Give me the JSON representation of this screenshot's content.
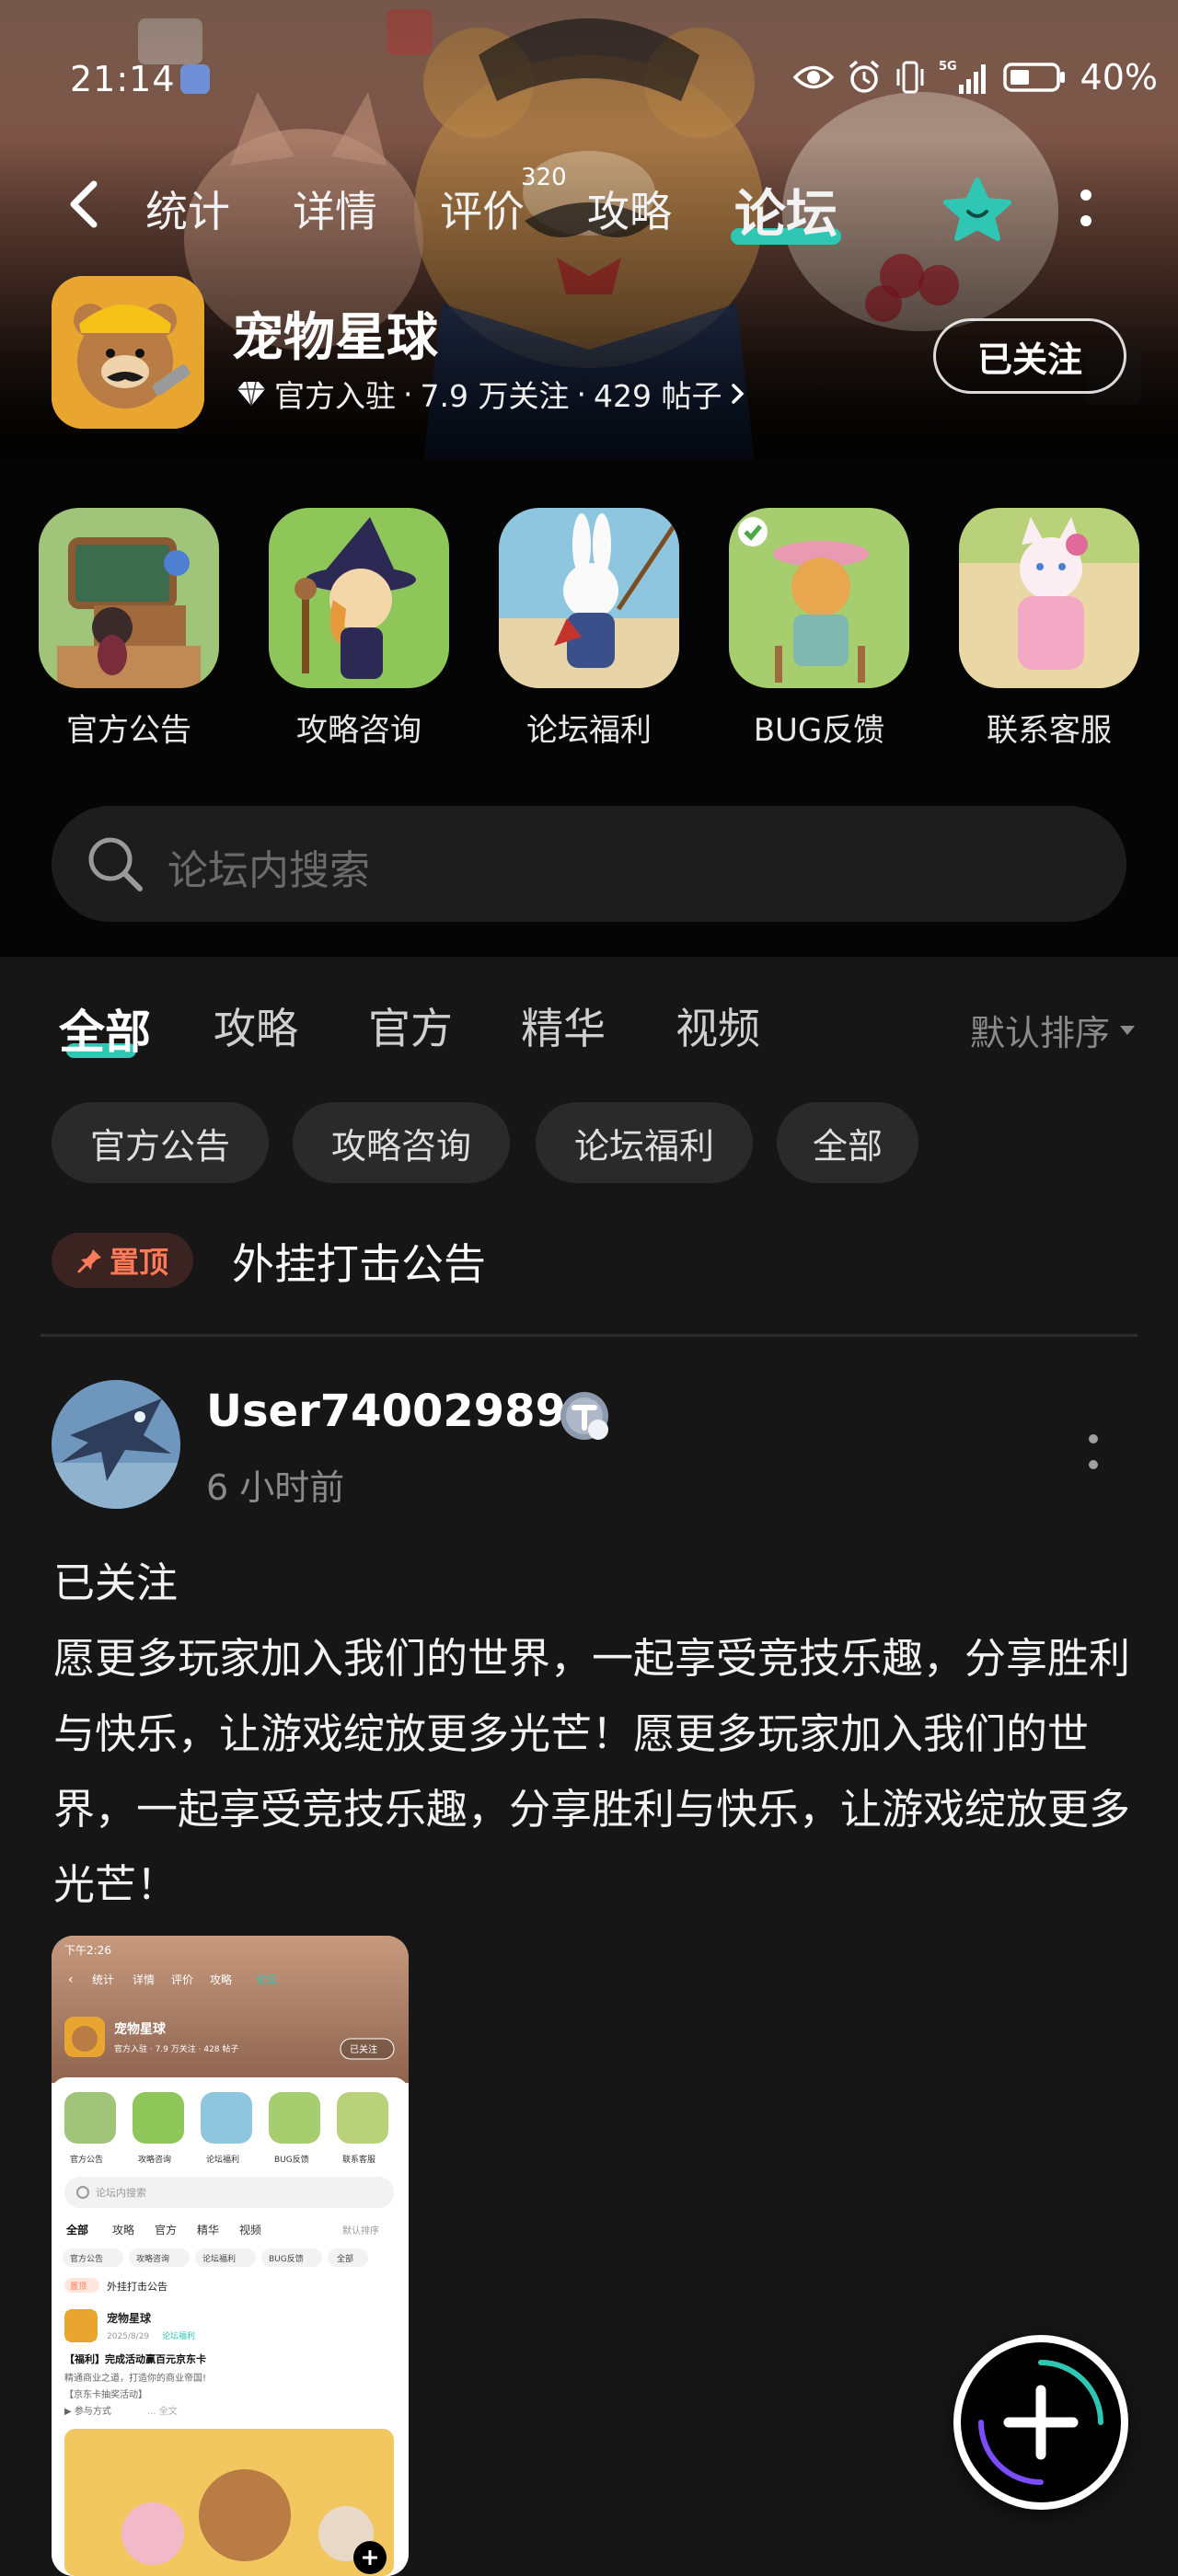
{
  "status_bar": {
    "time": "21:14",
    "network": "5G",
    "battery": "40%"
  },
  "nav": {
    "tabs": [
      {
        "label": "统计"
      },
      {
        "label": "详情"
      },
      {
        "label": "评价",
        "count": "320"
      },
      {
        "label": "攻略"
      },
      {
        "label": "论坛",
        "active": true
      }
    ],
    "accent": "#2fc7b4"
  },
  "game": {
    "title": "宠物星球",
    "official": "官方入驻",
    "followers": "7.9 万关注",
    "posts": "429 帖子",
    "sep": "·",
    "follow_label": "已关注"
  },
  "shortcuts": [
    {
      "label": "官方公告",
      "icon": "notice-board-icon"
    },
    {
      "label": "攻略咨询",
      "icon": "witch-cat-icon"
    },
    {
      "label": "论坛福利",
      "icon": "rabbit-fishing-icon"
    },
    {
      "label": "BUG反馈",
      "icon": "cat-farmer-icon"
    },
    {
      "label": "联系客服",
      "icon": "pink-cat-icon"
    }
  ],
  "search": {
    "placeholder": "论坛内搜索"
  },
  "content_tabs": [
    {
      "label": "全部",
      "active": true
    },
    {
      "label": "攻略"
    },
    {
      "label": "官方"
    },
    {
      "label": "精华"
    },
    {
      "label": "视频"
    }
  ],
  "sort_label": "默认排序",
  "chips": [
    "官方公告",
    "攻略咨询",
    "论坛福利",
    "全部"
  ],
  "pinned": {
    "badge": "置顶",
    "title": "外挂打击公告",
    "badge_color": "#ff7a59"
  },
  "post": {
    "username": "User740029894",
    "time": "6 小时前",
    "body_line1": "已关注",
    "body": "愿更多玩家加入我们的世界，一起享受竞技乐趣，分享胜利与快乐，让游戏绽放更多光芒！愿更多玩家加入我们的世界，一起享受竞技乐趣，分享胜利与快乐，让游戏绽放更多光芒！"
  },
  "thumbnail": {
    "time": "下午2:26",
    "tabs": [
      "统计",
      "详情",
      "评价",
      "攻略",
      "论坛"
    ],
    "title": "宠物星球",
    "meta": "官方入驻 · 7.9 万关注 · 428 帖子",
    "follow": "已关注",
    "shortcuts": [
      "官方公告",
      "攻略咨询",
      "论坛福利",
      "BUG反馈",
      "联系客服"
    ],
    "search": "论坛内搜索",
    "ctabs": [
      "全部",
      "攻略",
      "官方",
      "精华",
      "视频"
    ],
    "sort": "默认排序",
    "chips": [
      "官方公告",
      "攻略咨询",
      "论坛福利",
      "BUG反馈",
      "全部"
    ],
    "pin_badge": "置顶",
    "pin_title": "外挂打击公告",
    "author": "宠物星球",
    "date": "2025/8/29",
    "tag": "论坛福利",
    "post_title": "【福利】完成活动赢百元京东卡",
    "post_l1": "精通商业之道，打造你的商业帝国!",
    "post_l2": "【京东卡抽奖活动】",
    "post_l3": "▶ 参与方式",
    "post_l3b": "... 全文"
  }
}
